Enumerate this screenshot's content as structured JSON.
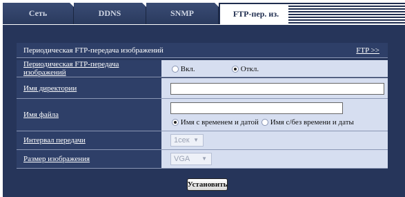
{
  "tabs": [
    {
      "label": "Сеть"
    },
    {
      "label": "DDNS"
    },
    {
      "label": "SNMP"
    },
    {
      "label": "FTP-пер. из."
    }
  ],
  "section": {
    "title": "Периодическая FTP-передача изображений",
    "link": "FTP >>"
  },
  "rows": {
    "periodic": {
      "label": "Периодическая FTP-передача изображений",
      "on_label": "Вкл.",
      "off_label": "Откл.",
      "selected": "off"
    },
    "directory": {
      "label": "Имя директории",
      "value": ""
    },
    "filename": {
      "label": "Имя файла",
      "value": "",
      "opt_with_time": "Имя с временем и датой",
      "opt_without_time": "Имя с/без времени и даты",
      "selected": "with_time"
    },
    "interval": {
      "label": "Интервал передачи",
      "value": "1сек"
    },
    "image_size": {
      "label": "Размер изображения",
      "value": "VGA"
    }
  },
  "submit_label": "Установить",
  "colors": {
    "panel": "#26355a",
    "label_bg": "#2e3f68",
    "value_bg": "#d6def0",
    "active_tab_text": "#1e2c4e"
  }
}
